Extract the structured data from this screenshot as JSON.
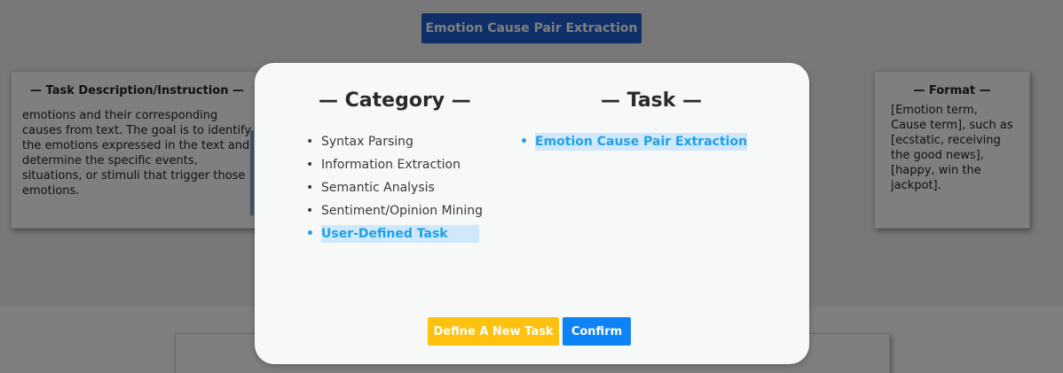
{
  "background": {
    "title_button": "Emotion Cause Pair Extraction",
    "description_card": {
      "title": "— Task Description/Instruction —",
      "text": "emotions and their corresponding causes from text. The goal is to identify the emotions expressed in the text and determine the specific events, situations, or stimuli that trigger those emotions."
    },
    "format_card": {
      "title": "— Format —",
      "text": "[Emotion term, Cause term], such as [ecstatic, receiving the good news], [happy, win the jackpot]."
    }
  },
  "modal": {
    "category_heading": "— Category —",
    "task_heading": "— Task —",
    "categories": [
      {
        "label": "Syntax Parsing",
        "selected": false
      },
      {
        "label": "Information Extraction",
        "selected": false
      },
      {
        "label": "Semantic Analysis",
        "selected": false
      },
      {
        "label": "Sentiment/Opinion Mining",
        "selected": false
      },
      {
        "label": "User-Defined Task",
        "selected": true
      }
    ],
    "tasks": [
      {
        "label": "Emotion Cause Pair Extraction",
        "selected": true
      }
    ],
    "define_button": "Define A New Task",
    "confirm_button": "Confirm"
  },
  "colors": {
    "title_button": "#1f5fd1",
    "selected_text": "#1fa0e6",
    "selected_highlight": "#cfe8fb",
    "define_button": "#fdc110",
    "confirm_button": "#0d83f5"
  }
}
